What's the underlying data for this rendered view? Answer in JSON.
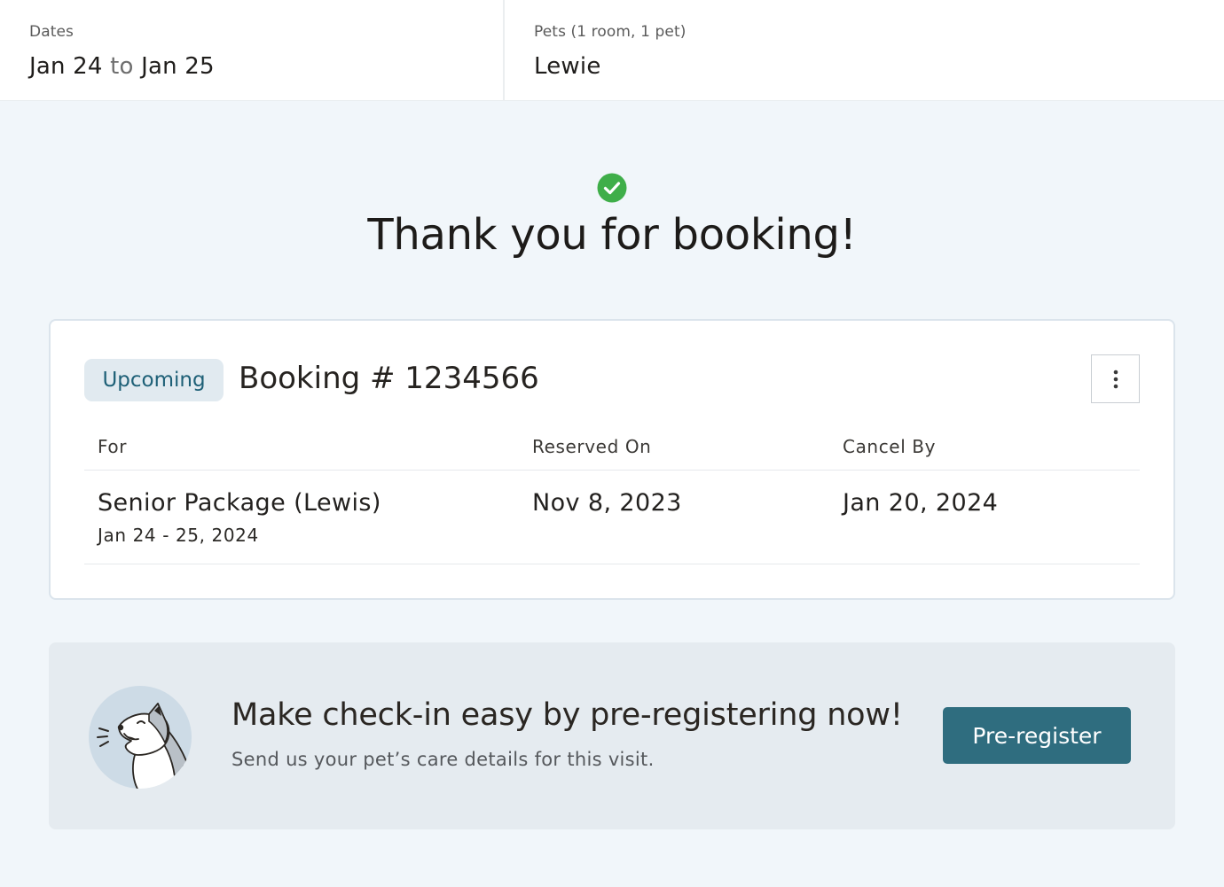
{
  "summary": {
    "dates_label": "Dates",
    "dates_from": "Jan 24",
    "dates_to_word": "to",
    "dates_to": "Jan 25",
    "pets_label": "Pets (1 room, 1 pet)",
    "pets_value": "Lewie"
  },
  "confirmation": {
    "icon": "check-circle-icon",
    "heading": "Thank you for booking!"
  },
  "booking": {
    "status_badge": "Upcoming",
    "title": "Booking # 1234566",
    "menu_icon": "more-vertical-icon",
    "columns": [
      "For",
      "Reserved On",
      "Cancel By"
    ],
    "row": {
      "service": "Senior Package (Lewis)",
      "service_dates": "Jan 24 - 25, 2024",
      "reserved_on": "Nov 8, 2023",
      "cancel_by": "Jan 20, 2024"
    }
  },
  "preregister": {
    "illustration": "dog-illustration",
    "title": "Make check-in easy by pre-registering now!",
    "subtitle": "Send us your pet’s care details for this visit.",
    "button_label": "Pre-register"
  },
  "colors": {
    "page_bg": "#f1f6fa",
    "accent_button": "#2f6d7f",
    "badge_bg": "#e1eaf0",
    "badge_text": "#1e6077",
    "success_green": "#3fae49",
    "banner_bg": "#e5ebf0"
  }
}
